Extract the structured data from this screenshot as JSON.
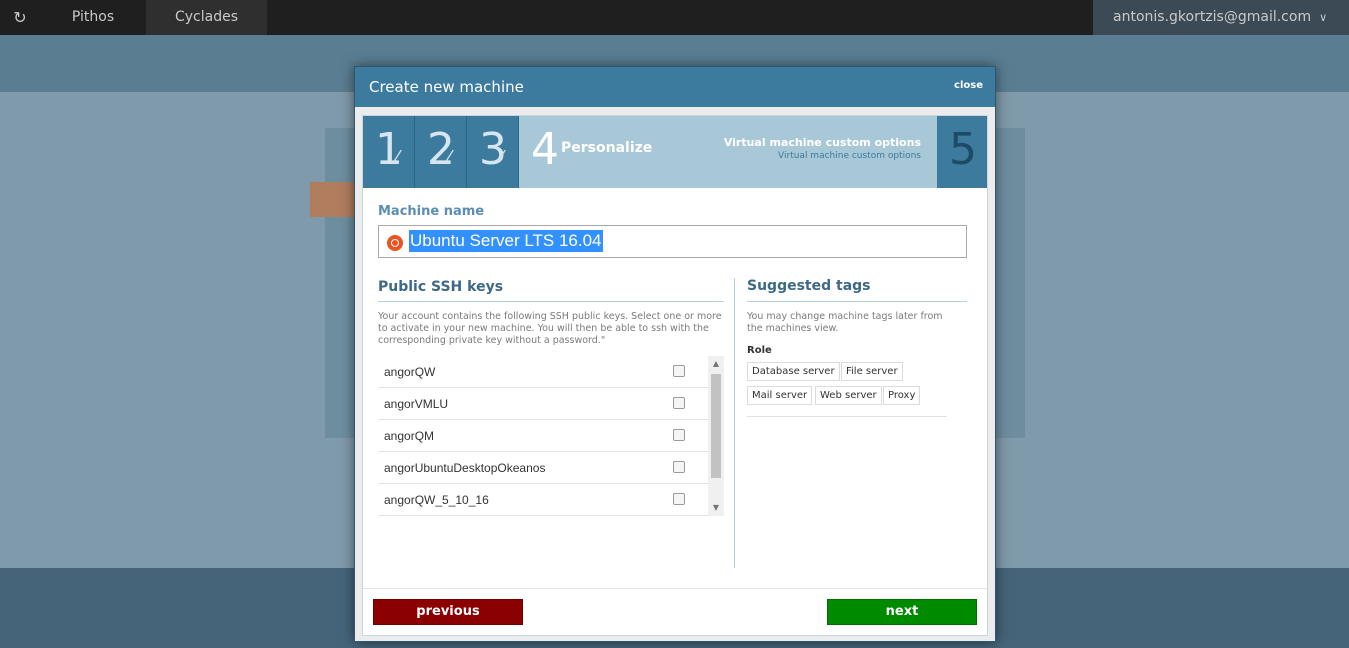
{
  "app": {
    "tabs": [
      "Pithos",
      "Cyclades"
    ],
    "user_email": "antonis.gkortzis@gmail.com"
  },
  "modal": {
    "title": "Create new machine",
    "close_label": "close",
    "steps": {
      "completed": [
        "1",
        "2",
        "3"
      ],
      "active_number": "4",
      "active_name": "Personalize",
      "active_desc_title": "Virtual machine custom options",
      "active_desc_sub": "Virtual machine custom options",
      "next_number": "5"
    },
    "machine_name_label": "Machine name",
    "machine_name_value": "Ubuntu Server LTS 16.04",
    "ssh": {
      "title": "Public SSH keys",
      "description": "Your account contains the following SSH public keys. Select one or more to activate in your new machine. You will then be able to ssh with the corresponding private key without a password.\"",
      "keys": [
        {
          "name": "angorQW",
          "checked": false
        },
        {
          "name": "angorVMLU",
          "checked": false
        },
        {
          "name": "angorQM",
          "checked": false
        },
        {
          "name": "angorUbuntuDesktopOkeanos",
          "checked": false
        },
        {
          "name": "angorQW_5_10_16",
          "checked": false
        }
      ]
    },
    "tags": {
      "title": "Suggested tags",
      "description": "You may change machine tags later from the machines view.",
      "role_label": "Role",
      "items": [
        "Database server",
        "File server",
        "Mail server",
        "Web server",
        "Proxy"
      ]
    },
    "buttons": {
      "previous": "previous",
      "next": "next"
    }
  },
  "colors": {
    "header": "#3c7a9e",
    "previous_button": "#8b0000",
    "next_button": "#008a00"
  }
}
